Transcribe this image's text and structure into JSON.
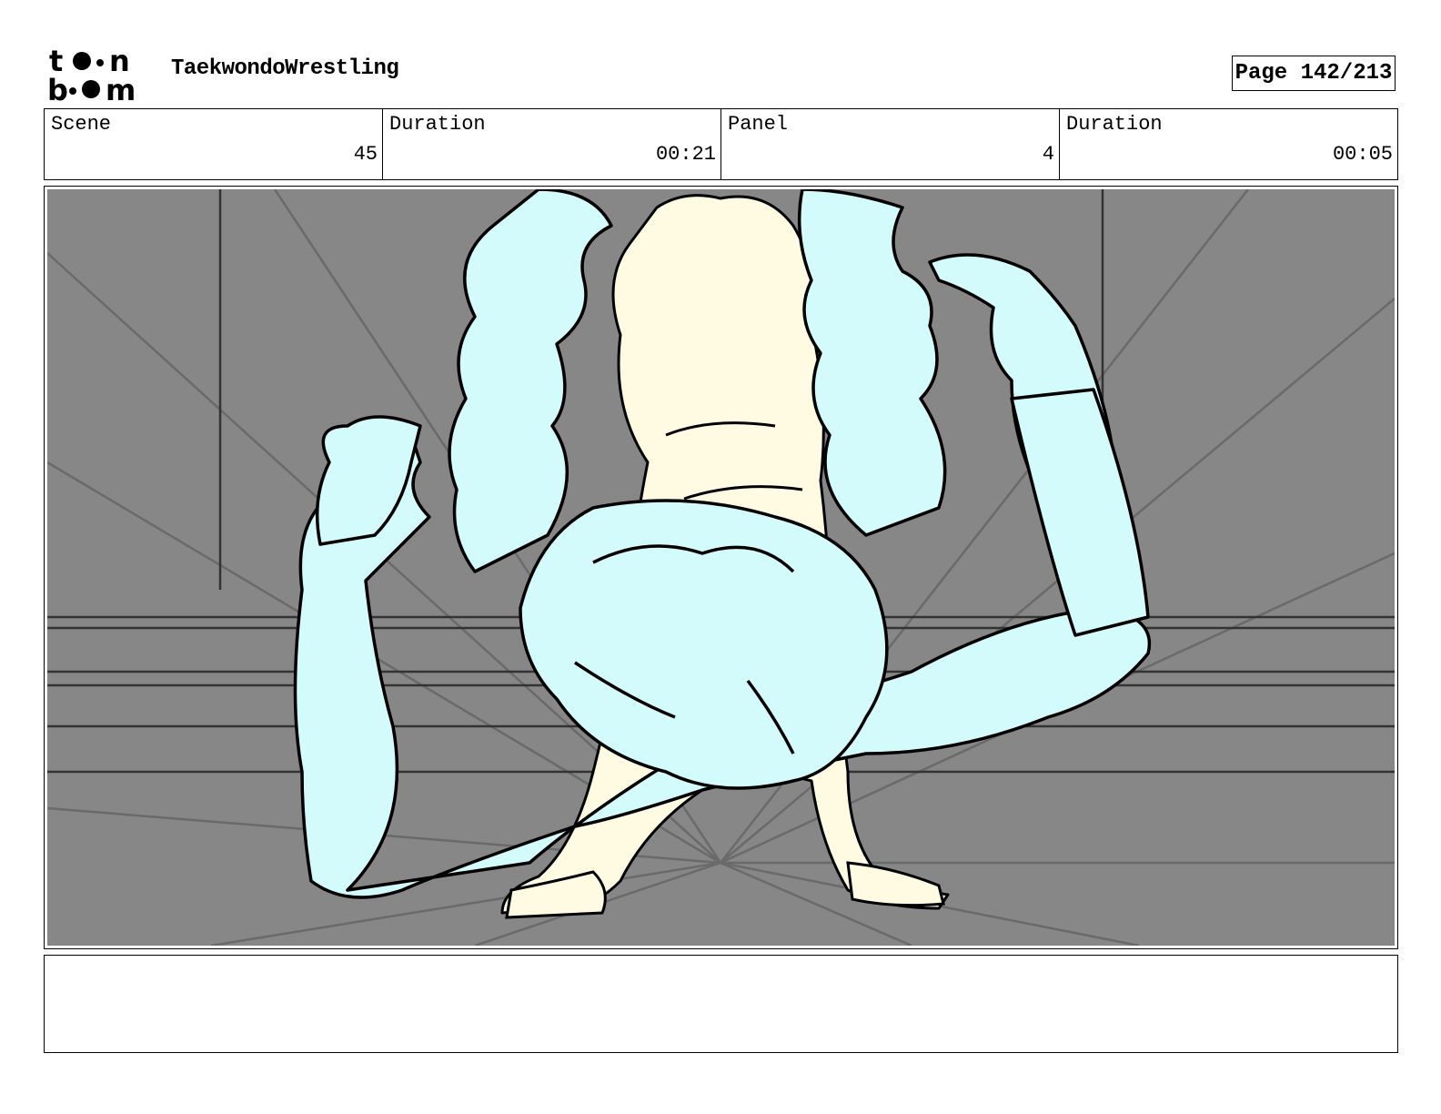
{
  "header": {
    "logo_text_top": "to n",
    "logo_text_bottom": "b m",
    "project_title": "TaekwondoWrestling",
    "page_indicator": "Page 142/213"
  },
  "info": [
    {
      "label": "Scene",
      "value": "45"
    },
    {
      "label": "Duration",
      "value": "00:21"
    },
    {
      "label": "Panel",
      "value": "4"
    },
    {
      "label": "Duration",
      "value": "00:05"
    }
  ],
  "panel": {
    "description": "",
    "colors": {
      "background": "#878787",
      "character_a_fill": "#d4fbfb",
      "character_b_fill": "#fffbe2",
      "line": "#000000",
      "speed_lines": "#6a6a6a"
    }
  },
  "notes": {
    "text": ""
  }
}
